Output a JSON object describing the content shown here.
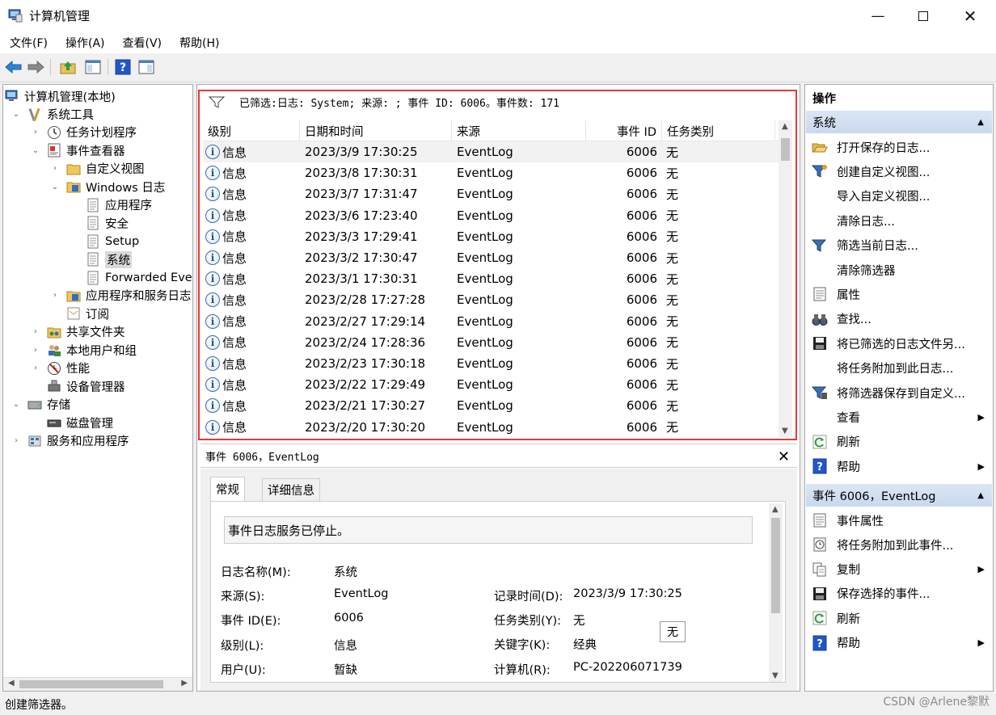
{
  "window": {
    "title": "计算机管理"
  },
  "menu": [
    "文件(F)",
    "操作(A)",
    "查看(V)",
    "帮助(H)"
  ],
  "tree": [
    {
      "label": "计算机管理(本地)",
      "level": 0,
      "arrow": "",
      "icon": "computer-icon"
    },
    {
      "label": "系统工具",
      "level": 1,
      "arrow": "expanded",
      "icon": "tools-icon"
    },
    {
      "label": "任务计划程序",
      "level": 2,
      "arrow": "collapsed",
      "icon": "clock-icon"
    },
    {
      "label": "事件查看器",
      "level": 2,
      "arrow": "expanded",
      "icon": "event-viewer-icon"
    },
    {
      "label": "自定义视图",
      "level": 3,
      "arrow": "collapsed",
      "icon": "folder-icon"
    },
    {
      "label": "Windows 日志",
      "level": 3,
      "arrow": "expanded",
      "icon": "log-folder-icon"
    },
    {
      "label": "应用程序",
      "level": 4,
      "arrow": "",
      "icon": "log-icon"
    },
    {
      "label": "安全",
      "level": 4,
      "arrow": "",
      "icon": "log-icon"
    },
    {
      "label": "Setup",
      "level": 4,
      "arrow": "",
      "icon": "log-icon"
    },
    {
      "label": "系统",
      "level": 4,
      "arrow": "",
      "icon": "log-icon",
      "selected": true
    },
    {
      "label": "Forwarded Even",
      "level": 4,
      "arrow": "",
      "icon": "log-icon"
    },
    {
      "label": "应用程序和服务日志",
      "level": 3,
      "arrow": "collapsed",
      "icon": "log-folder-icon"
    },
    {
      "label": "订阅",
      "level": 3,
      "arrow": "",
      "icon": "subscription-icon"
    },
    {
      "label": "共享文件夹",
      "level": 2,
      "arrow": "collapsed",
      "icon": "shared-folder-icon"
    },
    {
      "label": "本地用户和组",
      "level": 2,
      "arrow": "collapsed",
      "icon": "users-icon"
    },
    {
      "label": "性能",
      "level": 2,
      "arrow": "collapsed",
      "icon": "performance-icon"
    },
    {
      "label": "设备管理器",
      "level": 2,
      "arrow": "",
      "icon": "device-manager-icon"
    },
    {
      "label": "存储",
      "level": 1,
      "arrow": "expanded",
      "icon": "storage-icon"
    },
    {
      "label": "磁盘管理",
      "level": 2,
      "arrow": "",
      "icon": "disk-icon"
    },
    {
      "label": "服务和应用程序",
      "level": 1,
      "arrow": "collapsed",
      "icon": "services-icon"
    }
  ],
  "filter": {
    "text": "已筛选:日志: System; 来源: ; 事件 ID: 6006。事件数: 171"
  },
  "grid": {
    "columns": [
      "级别",
      "日期和时间",
      "来源",
      "事件 ID",
      "任务类别"
    ],
    "rows": [
      [
        "信息",
        "2023/3/9 17:30:25",
        "EventLog",
        "6006",
        "无"
      ],
      [
        "信息",
        "2023/3/8 17:30:31",
        "EventLog",
        "6006",
        "无"
      ],
      [
        "信息",
        "2023/3/7 17:31:47",
        "EventLog",
        "6006",
        "无"
      ],
      [
        "信息",
        "2023/3/6 17:23:40",
        "EventLog",
        "6006",
        "无"
      ],
      [
        "信息",
        "2023/3/3 17:29:41",
        "EventLog",
        "6006",
        "无"
      ],
      [
        "信息",
        "2023/3/2 17:30:47",
        "EventLog",
        "6006",
        "无"
      ],
      [
        "信息",
        "2023/3/1 17:30:31",
        "EventLog",
        "6006",
        "无"
      ],
      [
        "信息",
        "2023/2/28 17:27:28",
        "EventLog",
        "6006",
        "无"
      ],
      [
        "信息",
        "2023/2/27 17:29:14",
        "EventLog",
        "6006",
        "无"
      ],
      [
        "信息",
        "2023/2/24 17:28:36",
        "EventLog",
        "6006",
        "无"
      ],
      [
        "信息",
        "2023/2/23 17:30:18",
        "EventLog",
        "6006",
        "无"
      ],
      [
        "信息",
        "2023/2/22 17:29:49",
        "EventLog",
        "6006",
        "无"
      ],
      [
        "信息",
        "2023/2/21 17:30:27",
        "EventLog",
        "6006",
        "无"
      ],
      [
        "信息",
        "2023/2/20 17:30:20",
        "EventLog",
        "6006",
        "无"
      ]
    ]
  },
  "detail": {
    "header": "事件 6006，EventLog",
    "tabs": [
      "常规",
      "详细信息"
    ],
    "description": "事件日志服务已停止。",
    "fields_left": [
      {
        "label": "日志名称(M):",
        "value": "系统"
      },
      {
        "label": "来源(S):",
        "value": "EventLog"
      },
      {
        "label": "事件 ID(E):",
        "value": "6006"
      },
      {
        "label": "级别(L):",
        "value": "信息"
      },
      {
        "label": "用户(U):",
        "value": "暂缺"
      }
    ],
    "fields_right": [
      {
        "label": "记录时间(D):",
        "value": "2023/3/9 17:30:25"
      },
      {
        "label": "任务类别(Y):",
        "value": "无"
      },
      {
        "label": "关键字(K):",
        "value": "经典"
      },
      {
        "label": "计算机(R):",
        "value": "PC-202206071739"
      }
    ],
    "tooltip": "无"
  },
  "actions": {
    "title": "操作",
    "section1": {
      "title": "系统",
      "items": [
        {
          "label": "打开保存的日志...",
          "icon": "open-folder-icon"
        },
        {
          "label": "创建自定义视图...",
          "icon": "filter-create-icon"
        },
        {
          "label": "导入自定义视图...",
          "icon": ""
        },
        {
          "label": "清除日志...",
          "icon": ""
        },
        {
          "label": "筛选当前日志...",
          "icon": "filter-icon"
        },
        {
          "label": "清除筛选器",
          "icon": ""
        },
        {
          "label": "属性",
          "icon": "properties-icon"
        },
        {
          "label": "查找...",
          "icon": "binoculars-icon"
        },
        {
          "label": "将已筛选的日志文件另...",
          "icon": "save-icon"
        },
        {
          "label": "将任务附加到此日志...",
          "icon": ""
        },
        {
          "label": "将筛选器保存到自定义...",
          "icon": "filter-save-icon"
        },
        {
          "label": "查看",
          "icon": "",
          "submenu": true
        },
        {
          "label": "刷新",
          "icon": "refresh-icon"
        },
        {
          "label": "帮助",
          "icon": "help-icon",
          "submenu": true
        }
      ]
    },
    "section2": {
      "title": "事件 6006，EventLog",
      "items": [
        {
          "label": "事件属性",
          "icon": "properties-icon"
        },
        {
          "label": "将任务附加到此事件...",
          "icon": "task-icon"
        },
        {
          "label": "复制",
          "icon": "copy-icon",
          "submenu": true
        },
        {
          "label": "保存选择的事件...",
          "icon": "save-icon"
        },
        {
          "label": "刷新",
          "icon": "refresh-icon"
        },
        {
          "label": "帮助",
          "icon": "help-icon",
          "submenu": true
        }
      ]
    }
  },
  "status": {
    "text": "创建筛选器。"
  },
  "watermark": "CSDN @Arlene黎默"
}
